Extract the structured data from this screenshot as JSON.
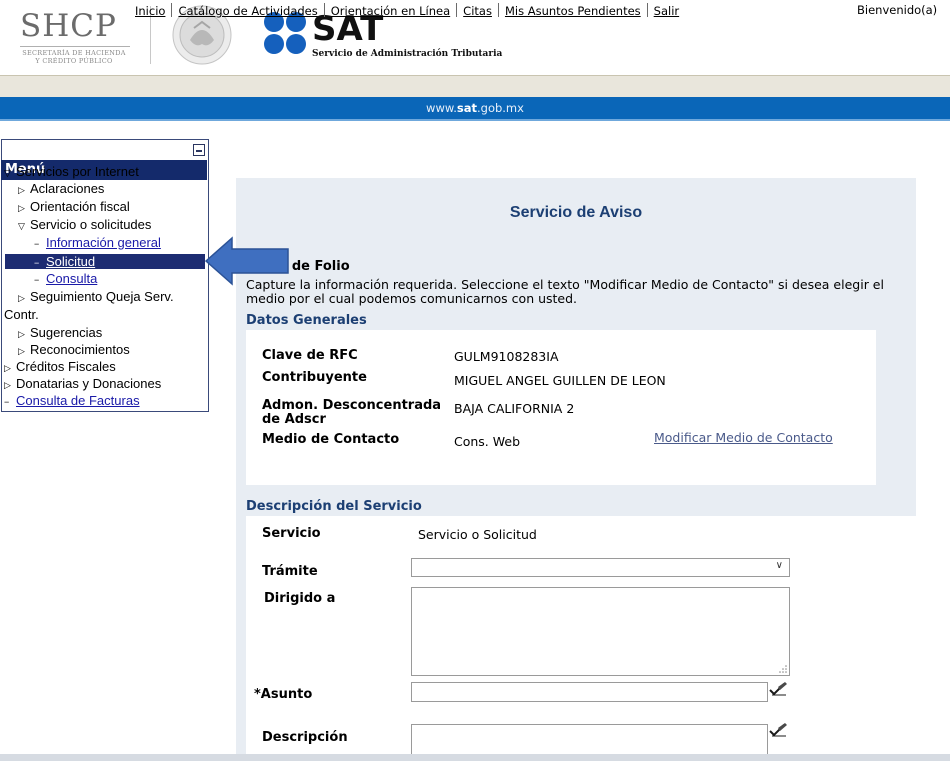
{
  "header": {
    "shcp_name": "SHCP",
    "shcp_subtitle_line1": "SECRETARÍA DE HACIENDA",
    "shcp_subtitle_line2": "Y CRÉDITO PÚBLICO",
    "sat_name": "SAT",
    "sat_subtitle": "Servicio de Administración Tributaria"
  },
  "nav": {
    "links": [
      "Inicio",
      "Catálogo de Actividades",
      "Orientación en Línea",
      "Citas",
      "Mis Asuntos Pendientes",
      "Salir"
    ],
    "welcome": "Bienvenido(a)"
  },
  "bluebar": {
    "url_prefix": "www.",
    "url_bold": "sat",
    "url_suffix": ".gob.mx"
  },
  "menu": {
    "title": "Menú",
    "items": [
      {
        "label": "Servicios por Internet",
        "marker": "▽"
      },
      {
        "label": "Aclaraciones",
        "marker": "▷"
      },
      {
        "label": "Orientación fiscal",
        "marker": "▷"
      },
      {
        "label": "Servicio o solicitudes",
        "marker": "▽"
      },
      {
        "label": "Información general",
        "marker": "−"
      },
      {
        "label": "Solicitud",
        "marker": "−"
      },
      {
        "label": "Consulta",
        "marker": "−"
      },
      {
        "label": "Seguimiento Queja Serv.",
        "marker": "▷"
      },
      {
        "label": "Contr.",
        "marker": ""
      },
      {
        "label": "Sugerencias",
        "marker": "▷"
      },
      {
        "label": "Reconocimientos",
        "marker": "▷"
      },
      {
        "label": "Créditos Fiscales",
        "marker": "▷"
      },
      {
        "label": "Donatarias y Donaciones",
        "marker": "▷"
      },
      {
        "label": "Consulta de Facturas",
        "marker": "−"
      }
    ]
  },
  "main": {
    "title": "Servicio de Aviso",
    "folio_label": "ro de Folio",
    "instructions": "Capture la información requerida. Seleccione el texto \"Modificar Medio de Contacto\" si desea elegir el medio por el cual podemos comunicarnos con usted.",
    "datos_title": "Datos Generales",
    "rfc_label": "Clave de RFC",
    "rfc_value": "GULM9108283IA",
    "contrib_label": "Contribuyente",
    "contrib_value": "MIGUEL ANGEL GUILLEN DE LEON",
    "admon_label_1": "Admon. Desconcentrada",
    "admon_label_2": "de Adscr",
    "admon_value": "BAJA CALIFORNIA 2",
    "medio_label": "Medio de Contacto",
    "medio_value": "Cons. Web",
    "modificar_link": "Modificar Medio de Contacto",
    "desc_title": "Descripción del Servicio",
    "servicio_label": "Servicio",
    "servicio_value": "Servicio o Solicitud",
    "tramite_label": "Trámite",
    "tramite_selected": "",
    "dirigido_label": "Dirigido a",
    "dirigido_value": "",
    "asunto_label": "*Asunto",
    "asunto_value": "",
    "descripcion_label": "Descripción",
    "descripcion_value": ""
  },
  "colors": {
    "menu_header": "#142a6b",
    "bluebar": "#0a66b8",
    "panel_bg": "#e8edf3",
    "section_title": "#1c3f73",
    "arrow": "#3f6fc0"
  }
}
